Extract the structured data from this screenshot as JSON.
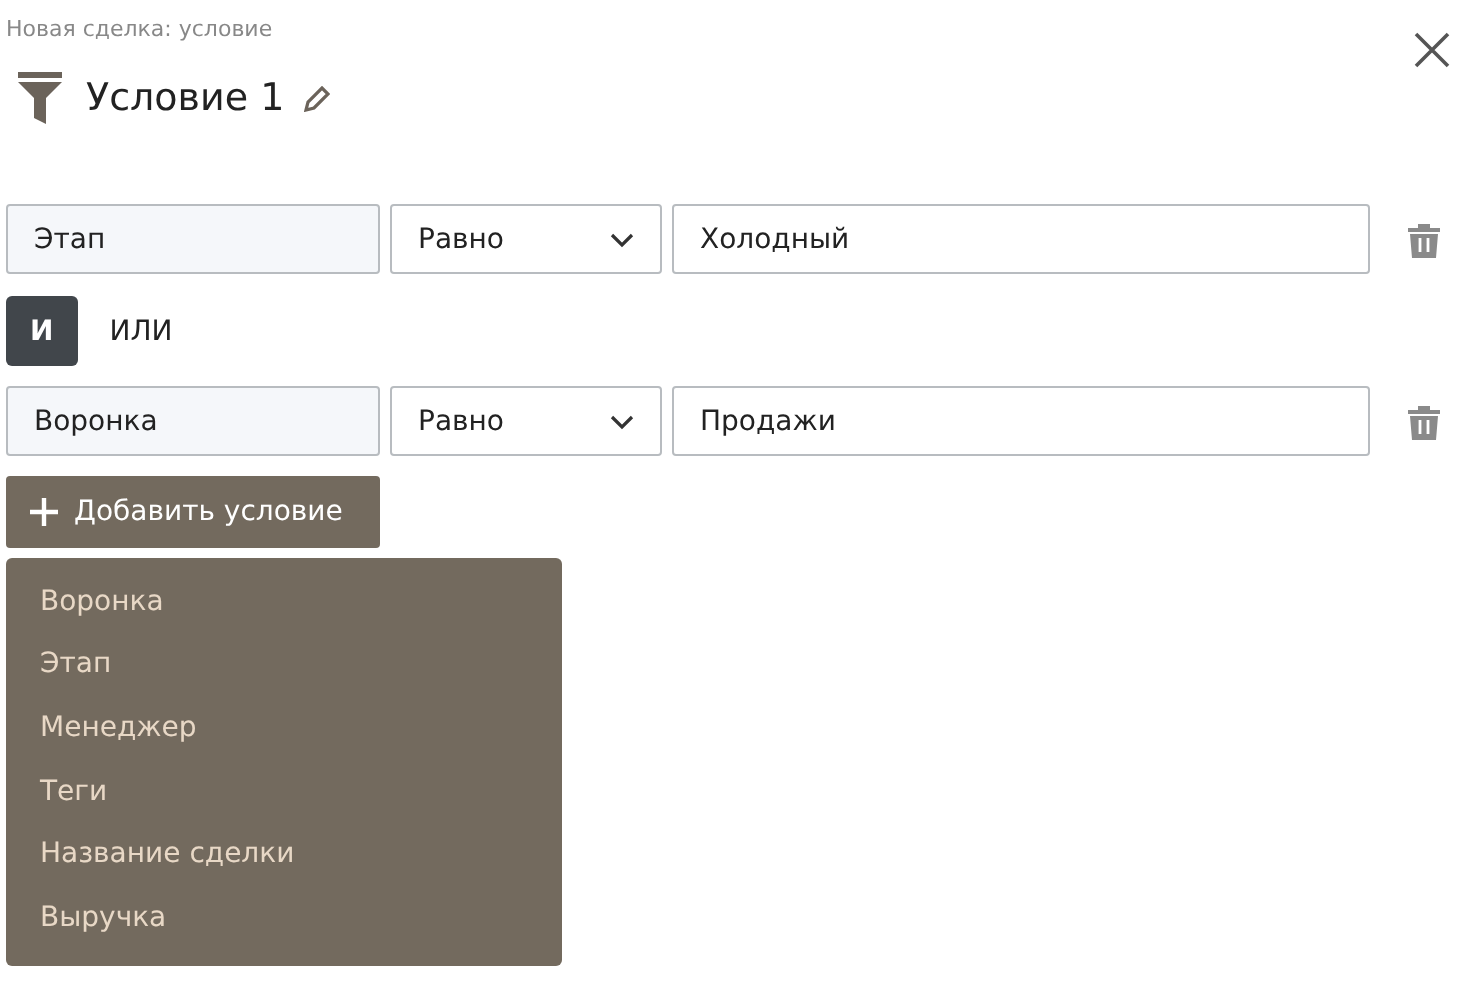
{
  "breadcrumb": "Новая сделка: условие",
  "title": "Условие 1",
  "conditions": [
    {
      "field": "Этап",
      "operator": "Равно",
      "value": "Холодный"
    },
    {
      "field": "Воронка",
      "operator": "Равно",
      "value": "Продажи"
    }
  ],
  "connectors": [
    {
      "label": "И",
      "selected": true
    },
    {
      "label": "ИЛИ",
      "selected": false
    }
  ],
  "add_button": "Добавить условие",
  "dropdown": {
    "items": [
      "Воронка",
      "Этап",
      "Менеджер",
      "Теги",
      "Название сделки",
      "Выручка"
    ]
  }
}
